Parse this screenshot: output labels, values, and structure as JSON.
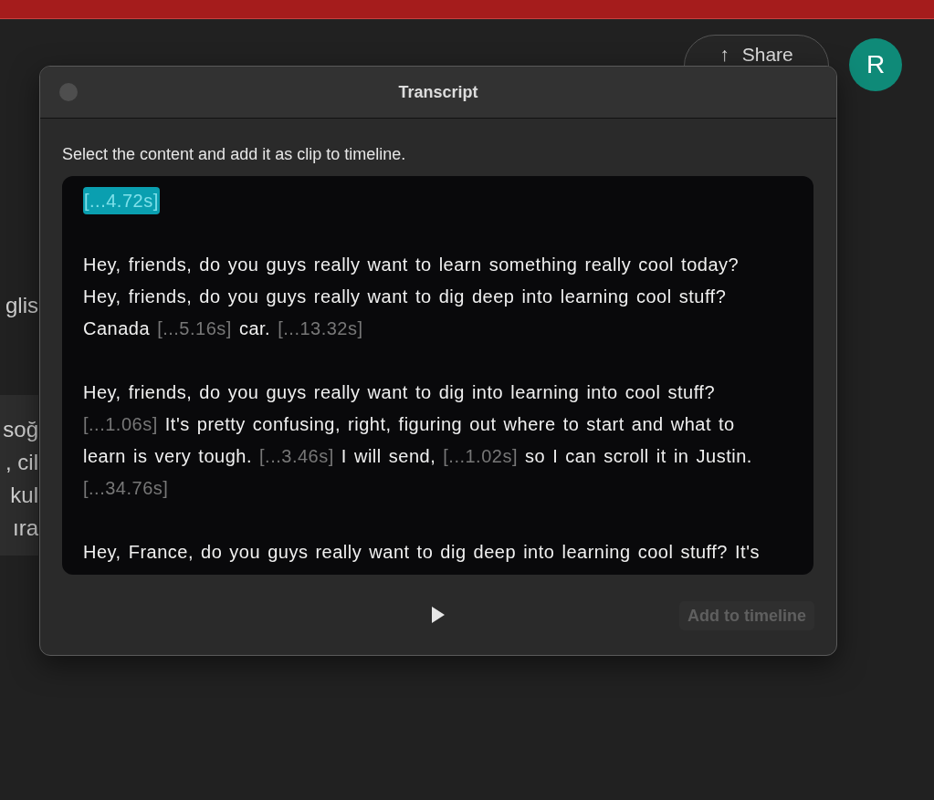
{
  "header": {
    "share_button": {
      "label": "Share",
      "icon": "↑"
    },
    "avatar": {
      "initial": "R"
    }
  },
  "background_text": [
    {
      "text": "glis",
      "kind": "plain"
    },
    {
      "text": "soğ",
      "kind": "block"
    },
    {
      "text": ", cil",
      "kind": "block"
    },
    {
      "text": " kul",
      "kind": "block"
    },
    {
      "text": "ıra",
      "kind": "block"
    }
  ],
  "dialog": {
    "title": "Transcript",
    "instruction": "Select the content and add it as clip to timeline.",
    "paragraphs": [
      {
        "segments": [
          {
            "kind": "pause",
            "text": "[...4.72s]",
            "selected": true
          }
        ]
      },
      {
        "segments": [
          {
            "kind": "speech",
            "text": "Hey, friends, do you guys really want to learn something really cool today? Hey, friends, do you guys really want to dig deep into learning cool stuff? Canada",
            "selected": false
          },
          {
            "kind": "pause",
            "text": "[...5.16s]",
            "selected": false
          },
          {
            "kind": "speech",
            "text": "car.",
            "selected": false
          },
          {
            "kind": "pause",
            "text": "[...13.32s]",
            "selected": false
          }
        ]
      },
      {
        "segments": [
          {
            "kind": "speech",
            "text": "Hey, friends, do you guys really want to dig into learning into cool stuff?",
            "selected": false
          },
          {
            "kind": "pause",
            "text": "[...1.06s]",
            "selected": false
          },
          {
            "kind": "speech",
            "text": "It's pretty confusing, right, figuring out where to start and what to learn is very tough.",
            "selected": false
          },
          {
            "kind": "pause",
            "text": "[...3.46s]",
            "selected": false
          },
          {
            "kind": "speech",
            "text": "I will send,",
            "selected": false
          },
          {
            "kind": "pause",
            "text": "[...1.02s]",
            "selected": false
          },
          {
            "kind": "speech",
            "text": "so I can scroll it in Justin.",
            "selected": false
          },
          {
            "kind": "pause",
            "text": "[...34.76s]",
            "selected": false
          }
        ]
      },
      {
        "segments": [
          {
            "kind": "speech",
            "text": "Hey, France, do you guys really want to dig deep into learning cool stuff? It's",
            "selected": false
          }
        ]
      }
    ],
    "add_button": {
      "label": "Add to timeline",
      "disabled": true
    }
  }
}
